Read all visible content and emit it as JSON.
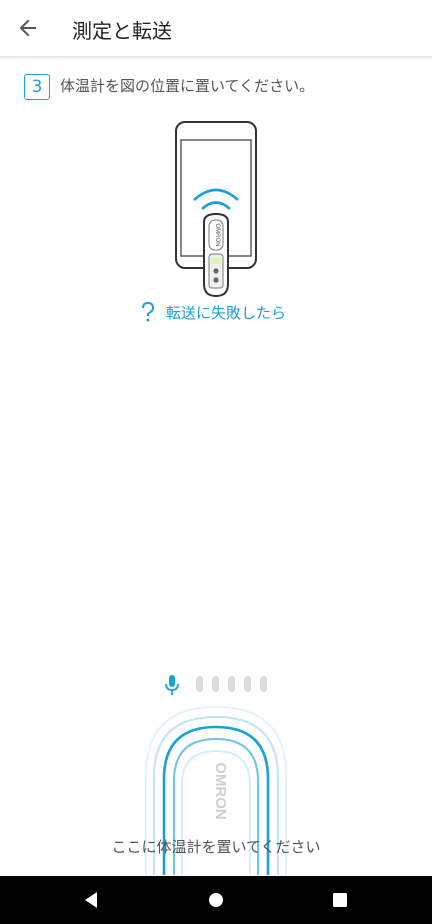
{
  "appbar": {
    "title": "測定と転送",
    "back_icon": "arrow-left-icon"
  },
  "step": {
    "number": "3",
    "instruction": "体温計を図の位置に置いてください。"
  },
  "illustration": {
    "brand": "OMRON",
    "wave_color": "#1aa0d8",
    "screen_glow": "#d8f6b0"
  },
  "help": {
    "icon": "question-icon",
    "label": "転送に失敗したら"
  },
  "audio_meter": {
    "icon": "microphone-icon",
    "level": 0,
    "bars": 5
  },
  "placement": {
    "brand": "OMRON",
    "hint": "ここに体温計を置いてください",
    "guide_color": "#1aa0d8"
  },
  "colors": {
    "accent": "#1aa0d8",
    "text": "#555555",
    "nav_bar": "#000000"
  },
  "navbar": {
    "back_icon": "nav-back-icon",
    "home_icon": "nav-home-icon",
    "recents_icon": "nav-recents-icon"
  }
}
